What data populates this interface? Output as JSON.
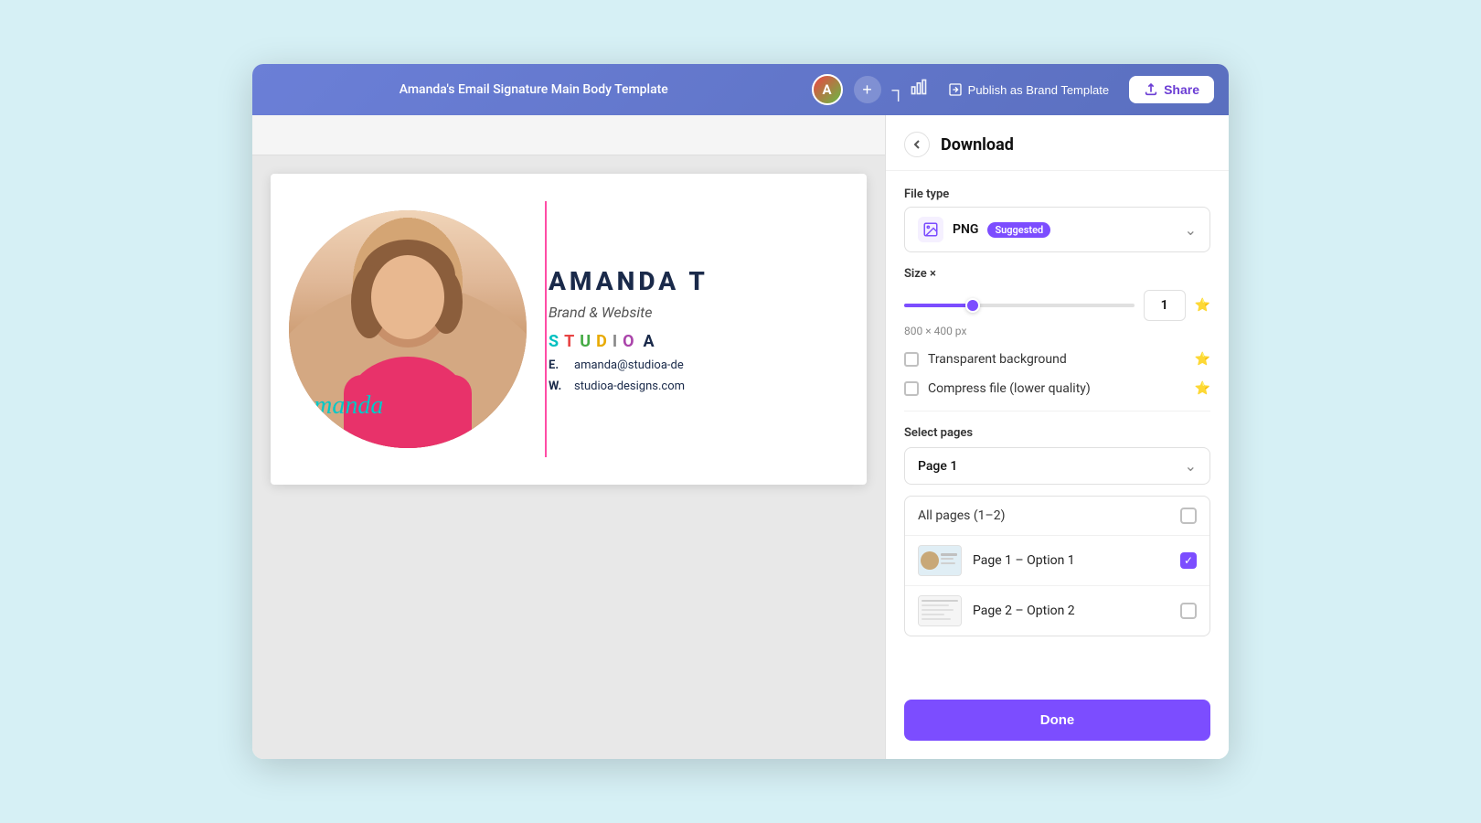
{
  "header": {
    "title": "Amanda's Email Signature Main Body Template",
    "avatar_letter": "A",
    "plus_label": "+",
    "publish_label": "Publish as Brand Template",
    "share_label": "Share"
  },
  "download_panel": {
    "title": "Download",
    "back_label": "‹",
    "file_type_label": "File type",
    "file_type_name": "PNG",
    "file_type_badge": "Suggested",
    "size_label": "Size ×",
    "size_value": "1",
    "size_px": "800 × 400 px",
    "slider_percent": 30,
    "transparent_bg_label": "Transparent background",
    "compress_label": "Compress file (lower quality)",
    "select_pages_label": "Select pages",
    "selected_page": "Page 1",
    "all_pages_label": "All pages (1–2)",
    "pages": [
      {
        "name": "Page 1 – Option 1",
        "checked": true
      },
      {
        "name": "Page 2 – Option 2",
        "checked": false
      }
    ],
    "done_label": "Done"
  },
  "design": {
    "name": "AMANDA T",
    "subtitle": "Brand & Website",
    "studio_text": "STUDIO A",
    "email_label": "E.",
    "email_value": "amanda@studioa-de",
    "web_label": "W.",
    "web_value": "studioa-designs.com",
    "signature": "Amanda"
  },
  "icons": {
    "chart": "📊",
    "upload": "↑",
    "share_box": "⬆",
    "document": "📄",
    "image_icon": "🖼"
  }
}
